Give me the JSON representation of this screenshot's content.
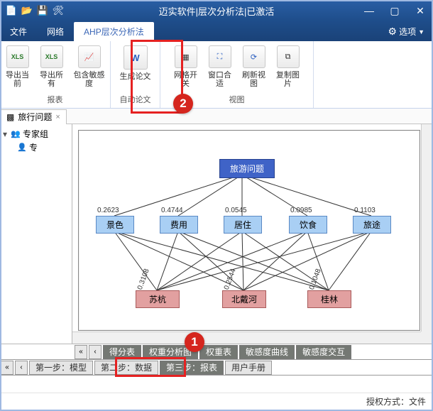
{
  "window": {
    "title": "迈实软件|层次分析法|已激活"
  },
  "menu": {
    "file": "文件",
    "network": "网络",
    "ahp": "AHP层次分析法",
    "options": "选项"
  },
  "ribbon": {
    "export_current": "导出当前",
    "export_all": "导出所有",
    "include_sens": "包含敏感度",
    "group_report": "报表",
    "gen_paper": "生成论文",
    "group_auto": "自动论文",
    "grid_toggle": "网格开关",
    "fit_window": "窗口合适",
    "refresh": "刷新视图",
    "copy_image": "复制图片",
    "group_view": "视图"
  },
  "doc": {
    "tab1": "旅行问题"
  },
  "tree": {
    "root": "专家组",
    "child": "专"
  },
  "graph": {
    "top": "旅游问题",
    "mid": [
      {
        "label": "景色",
        "value": "0.2623"
      },
      {
        "label": "费用",
        "value": "0.4744"
      },
      {
        "label": "居住",
        "value": "0.0545"
      },
      {
        "label": "饮食",
        "value": "0.0985"
      },
      {
        "label": "旅途",
        "value": "0.1103"
      }
    ],
    "bot": [
      {
        "label": "苏杭",
        "value": "0.3108"
      },
      {
        "label": "北戴河",
        "value": "0.2544"
      },
      {
        "label": "桂林",
        "value": "0.1048"
      }
    ]
  },
  "innertabs": {
    "score": "得分表",
    "t2": "权重分析图",
    "t3": "权重表",
    "sens_curve": "敏感度曲线",
    "sens_inter": "敏感度交互"
  },
  "steptabs": {
    "s1": "第一步：模型",
    "s2": "第二步：数据",
    "s3": "第三步：报表",
    "manual": "用户手册"
  },
  "status": {
    "auth": "授权方式：文件"
  },
  "badges": {
    "b1": "1",
    "b2": "2"
  }
}
